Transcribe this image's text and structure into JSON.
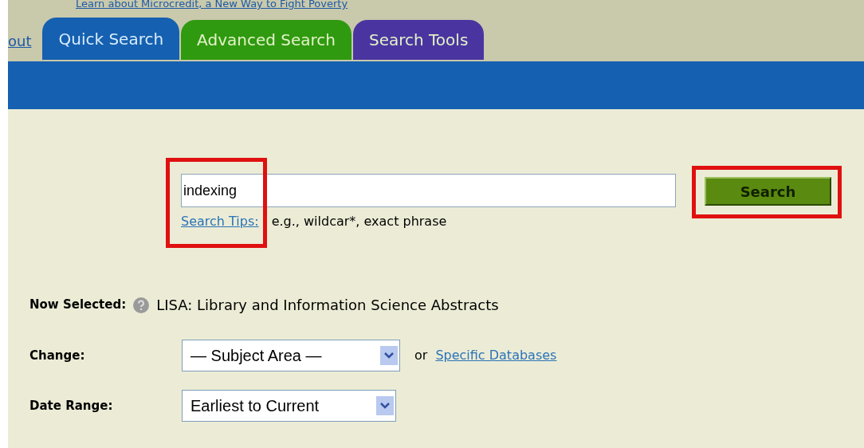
{
  "top_link": "Learn about Microcredit, a New Way to Fight Poverty",
  "side_link": "out",
  "tabs": [
    {
      "label": "Quick Search",
      "selected": true,
      "color": "#1560b0"
    },
    {
      "label": "Advanced Search",
      "selected": false,
      "color": "#2f9a10"
    },
    {
      "label": "Search Tools",
      "selected": false,
      "color": "#4a35a0"
    }
  ],
  "search": {
    "value": "indexing",
    "field_highlighted": true,
    "tips_link": "Search Tips:",
    "tips_text": "e.g., wildcar*, exact phrase",
    "button": "Search",
    "button_highlighted": true
  },
  "now_selected": {
    "label": "Now Selected:",
    "value": "LISA: Library and Information Science Abstracts"
  },
  "change": {
    "label": "Change:",
    "select": "— Subject Area —",
    "or": "or",
    "link": "Specific Databases"
  },
  "date_range": {
    "label": "Date Range:",
    "select": "Earliest to Current"
  }
}
